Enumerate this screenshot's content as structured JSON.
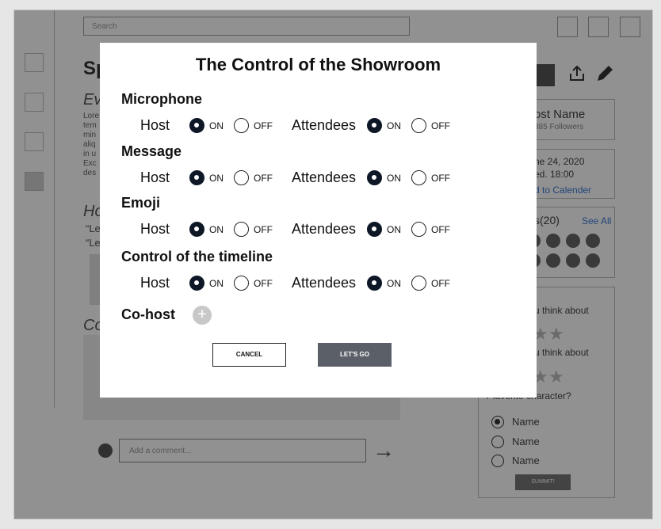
{
  "background": {
    "search_placeholder": "Search",
    "page_title": "Sp",
    "event_subtitle": "Ev",
    "paragraph_lines": [
      "Lore",
      "tem",
      "min",
      "aliq",
      "in u",
      "Exc",
      "des"
    ],
    "section_heading": "Ho",
    "quotes": [
      "“Le",
      "“Le"
    ],
    "comments_heading": "Co",
    "comment_placeholder": "Add a comment...",
    "host_card": {
      "name": "ost Name",
      "followers": "385 Followers"
    },
    "date_card": {
      "date": "ne 24, 2020",
      "time": "ed. 18:00",
      "add_calendar": "d to Calender"
    },
    "attendees_card": {
      "label": "s(20)",
      "see_all": "See All"
    },
    "poll": {
      "q1": "u think about",
      "q2": "u think about",
      "q3": "r favorite character?",
      "options": [
        "Name",
        "Name",
        "Name"
      ],
      "submit": "SUMMIT!"
    }
  },
  "modal": {
    "title": "The Control of the Showroom",
    "sections": [
      {
        "name": "Microphone",
        "host_label": "Host",
        "host_value": "ON",
        "attendees_label": "Attendees",
        "attendees_value": "ON"
      },
      {
        "name": "Message",
        "host_label": "Host",
        "host_value": "ON",
        "attendees_label": "Attendees",
        "attendees_value": "ON"
      },
      {
        "name": "Emoji",
        "host_label": "Host",
        "host_value": "ON",
        "attendees_label": "Attendees",
        "attendees_value": "ON"
      },
      {
        "name": "Control of the timeline",
        "host_label": "Host",
        "host_value": "ON",
        "attendees_label": "Attendees",
        "attendees_value": "ON"
      }
    ],
    "on_label": "ON",
    "off_label": "OFF",
    "cohost_label": "Co-host",
    "cohost_add": "+",
    "cancel_label": "CANCEL",
    "go_label": "LET'S GO"
  },
  "colors": {
    "overlay": "rgba(0,0,0,0.43)",
    "radio_on": "#0d1726",
    "primary_button": "#5b6068"
  }
}
